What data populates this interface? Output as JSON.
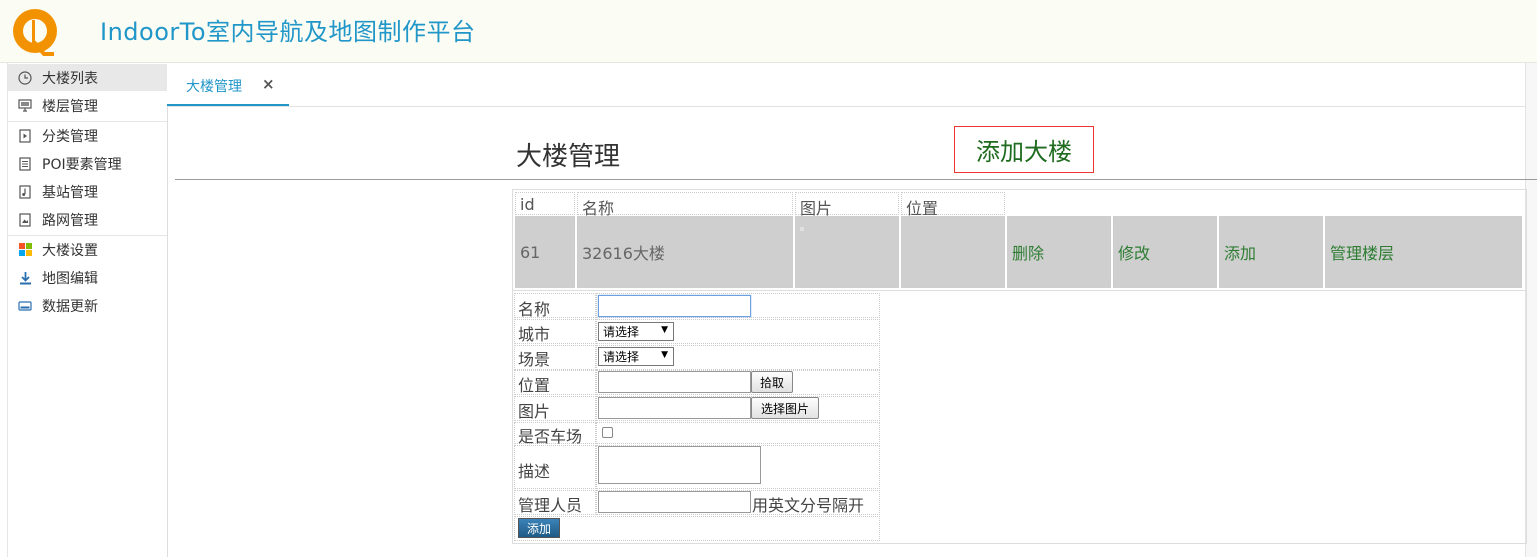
{
  "app": {
    "title": "IndoorTo室内导航及地图制作平台"
  },
  "sidebar": {
    "items": [
      {
        "label": "大楼列表",
        "icon": "clock-icon"
      },
      {
        "label": "楼层管理",
        "icon": "monitor-icon"
      },
      {
        "label": "分类管理",
        "icon": "play-file-icon"
      },
      {
        "label": "POI要素管理",
        "icon": "document-icon"
      },
      {
        "label": "基站管理",
        "icon": "music-file-icon"
      },
      {
        "label": "路网管理",
        "icon": "image-file-icon"
      },
      {
        "label": "大楼设置",
        "icon": "windows-icon"
      },
      {
        "label": "地图编辑",
        "icon": "download-icon"
      },
      {
        "label": "数据更新",
        "icon": "drive-icon"
      }
    ]
  },
  "tabs": [
    {
      "label": "大楼管理",
      "close": "×"
    }
  ],
  "main": {
    "title": "大楼管理",
    "add_button": "添加大楼",
    "table": {
      "headers": [
        "id",
        "名称",
        "图片",
        "位置"
      ],
      "rows": [
        {
          "id": "61",
          "name": "32616大楼",
          "image": "",
          "position": "",
          "actions": [
            "删除",
            "修改",
            "添加",
            "管理楼层"
          ]
        }
      ]
    },
    "form": {
      "name_label": "名称",
      "name_value": "",
      "city_label": "城市",
      "city_value": "请选择",
      "scene_label": "场景",
      "scene_value": "请选择",
      "position_label": "位置",
      "position_value": "",
      "pick_button": "拾取",
      "image_label": "图片",
      "image_value": "",
      "choose_image_button": "选择图片",
      "parking_label": "是否车场",
      "desc_label": "描述",
      "manager_label": "管理人员",
      "manager_value": "",
      "manager_hint": "用英文分号隔开",
      "submit_button": "添加"
    }
  },
  "colors": {
    "accent": "#2196c8",
    "action_green": "#2e7d32",
    "logo_orange": "#f39200"
  }
}
